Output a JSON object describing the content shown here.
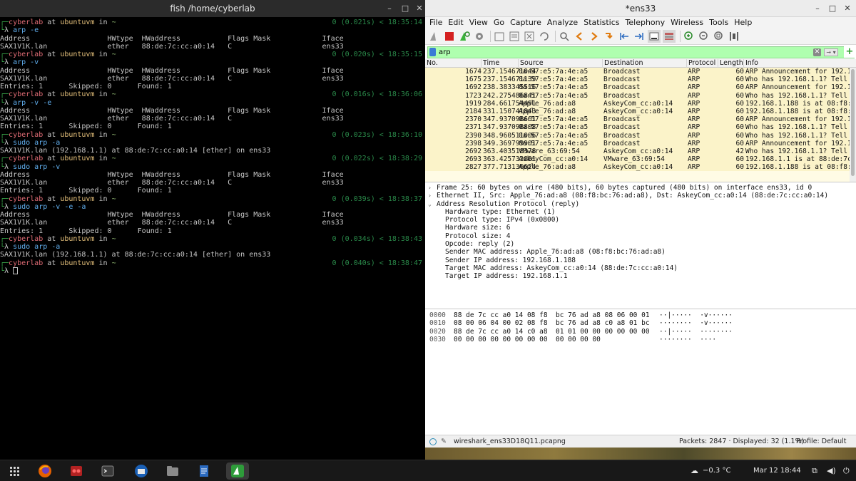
{
  "terminal": {
    "title": "fish /home/cyberlab",
    "lines": [
      {
        "t": "prompt",
        "user": "cyberlab",
        "at": " at ",
        "host": "ubuntuvm",
        "in": " in ",
        "dir": "~",
        "duration": "0 (0.021s)",
        "time": "< 18:35:14"
      },
      {
        "t": "cmd",
        "text": "arp -e"
      },
      {
        "t": "out",
        "text": "Address                  HWtype  HWaddress           Flags Mask            Iface"
      },
      {
        "t": "out",
        "text": "SAX1V1K.lan              ether   88:de:7c:cc:a0:14   C                     ens33"
      },
      {
        "t": "prompt",
        "user": "cyberlab",
        "at": " at ",
        "host": "ubuntuvm",
        "in": " in ",
        "dir": "~",
        "duration": "0 (0.020s)",
        "time": "< 18:35:15"
      },
      {
        "t": "cmd",
        "text": "arp -v"
      },
      {
        "t": "out",
        "text": "Address                  HWtype  HWaddress           Flags Mask            Iface"
      },
      {
        "t": "out",
        "text": "SAX1V1K.lan              ether   88:de:7c:cc:a0:14   C                     ens33"
      },
      {
        "t": "out",
        "text": "Entries: 1      Skipped: 0      Found: 1"
      },
      {
        "t": "prompt",
        "user": "cyberlab",
        "at": " at ",
        "host": "ubuntuvm",
        "in": " in ",
        "dir": "~",
        "duration": "0 (0.016s)",
        "time": "< 18:36:06"
      },
      {
        "t": "cmd",
        "text": "arp -v -e"
      },
      {
        "t": "out",
        "text": "Address                  HWtype  HWaddress           Flags Mask            Iface"
      },
      {
        "t": "out",
        "text": "SAX1V1K.lan              ether   88:de:7c:cc:a0:14   C                     ens33"
      },
      {
        "t": "out",
        "text": "Entries: 1      Skipped: 0      Found: 1"
      },
      {
        "t": "prompt",
        "user": "cyberlab",
        "at": " at ",
        "host": "ubuntuvm",
        "in": " in ",
        "dir": "~",
        "duration": "0 (0.023s)",
        "time": "< 18:36:10"
      },
      {
        "t": "cmd",
        "text": "sudo arp -a"
      },
      {
        "t": "out",
        "text": "SAX1V1K.lan (192.168.1.1) at 88:de:7c:cc:a0:14 [ether] on ens33"
      },
      {
        "t": "prompt",
        "user": "cyberlab",
        "at": " at ",
        "host": "ubuntuvm",
        "in": " in ",
        "dir": "~",
        "duration": "0 (0.022s)",
        "time": "< 18:38:29"
      },
      {
        "t": "cmd",
        "text": "sudo arp -v"
      },
      {
        "t": "out",
        "text": "Address                  HWtype  HWaddress           Flags Mask            Iface"
      },
      {
        "t": "out",
        "text": "SAX1V1K.lan              ether   88:de:7c:cc:a0:14   C                     ens33"
      },
      {
        "t": "out",
        "text": "Entries: 1      Skipped: 0      Found: 1"
      },
      {
        "t": "prompt",
        "user": "cyberlab",
        "at": " at ",
        "host": "ubuntuvm",
        "in": " in ",
        "dir": "~",
        "duration": "0 (0.039s)",
        "time": "< 18:38:37"
      },
      {
        "t": "cmd",
        "text": "sudo arp -v -e -a"
      },
      {
        "t": "out",
        "text": "Address                  HWtype  HWaddress           Flags Mask            Iface"
      },
      {
        "t": "out",
        "text": "SAX1V1K.lan              ether   88:de:7c:cc:a0:14   C                     ens33"
      },
      {
        "t": "out",
        "text": "Entries: 1      Skipped: 0      Found: 1"
      },
      {
        "t": "prompt",
        "user": "cyberlab",
        "at": " at ",
        "host": "ubuntuvm",
        "in": " in ",
        "dir": "~",
        "duration": "0 (0.034s)",
        "time": "< 18:38:43"
      },
      {
        "t": "cmd",
        "text": "sudo arp -a"
      },
      {
        "t": "out",
        "text": "SAX1V1K.lan (192.168.1.1) at 88:de:7c:cc:a0:14 [ether] on ens33"
      },
      {
        "t": "prompt",
        "user": "cyberlab",
        "at": " at ",
        "host": "ubuntuvm",
        "in": " in ",
        "dir": "~",
        "duration": "0 (0.040s)",
        "time": "< 18:38:47"
      },
      {
        "t": "input",
        "text": ""
      }
    ]
  },
  "wireshark": {
    "title": "*ens33",
    "menu": [
      "File",
      "Edit",
      "View",
      "Go",
      "Capture",
      "Analyze",
      "Statistics",
      "Telephony",
      "Wireless",
      "Tools",
      "Help"
    ],
    "toolbar_icons": [
      "shark-fin-icon",
      "stop-icon",
      "restart-icon",
      "options-gear-icon",
      "open-folder-icon",
      "save-icon",
      "close-file-icon",
      "reload-icon",
      "find-icon",
      "back-icon",
      "forward-icon",
      "goto-packet-icon",
      "first-packet-icon",
      "last-packet-icon",
      "autoscroll-icon",
      "colorize-icon",
      "zoom-in-icon",
      "zoom-out-icon",
      "zoom-normal-icon",
      "resize-columns-icon"
    ],
    "filter": {
      "value": "arp"
    },
    "columns": [
      "No.",
      "Time",
      "Source",
      "Destination",
      "Protocol",
      "Length",
      "Info"
    ],
    "packets": [
      {
        "no": "1674",
        "time": "237.154671044",
        "src": "0a:57:e5:7a:4e:a5",
        "dst": "Broadcast",
        "proto": "ARP",
        "len": "60",
        "info": "ARP Announcement for 192.1"
      },
      {
        "no": "1675",
        "time": "237.154671139",
        "src": "0a:57:e5:7a:4e:a5",
        "dst": "Broadcast",
        "proto": "ARP",
        "len": "60",
        "info": "Who has 192.168.1.1? Tell"
      },
      {
        "no": "1692",
        "time": "238.383345516",
        "src": "0a:57:e5:7a:4e:a5",
        "dst": "Broadcast",
        "proto": "ARP",
        "len": "60",
        "info": "ARP Announcement for 192.1"
      },
      {
        "no": "1723",
        "time": "242.275486841",
        "src": "0a:57:e5:7a:4e:a5",
        "dst": "Broadcast",
        "proto": "ARP",
        "len": "60",
        "info": "Who has 192.168.1.1? Tell"
      },
      {
        "no": "1919",
        "time": "284.661754491",
        "src": "Apple_76:ad:a8",
        "dst": "AskeyCom_cc:a0:14",
        "proto": "ARP",
        "len": "60",
        "info": "192.168.1.188 is at 08:f8:"
      },
      {
        "no": "2184",
        "time": "331.150741843",
        "src": "Apple_76:ad:a8",
        "dst": "AskeyCom_cc:a0:14",
        "proto": "ARP",
        "len": "60",
        "info": "192.168.1.188 is at 08:f8:"
      },
      {
        "no": "2370",
        "time": "347.937098661",
        "src": "0a:57:e5:7a:4e:a5",
        "dst": "Broadcast",
        "proto": "ARP",
        "len": "60",
        "info": "ARP Announcement for 192.1"
      },
      {
        "no": "2371",
        "time": "347.937098808",
        "src": "0a:57:e5:7a:4e:a5",
        "dst": "Broadcast",
        "proto": "ARP",
        "len": "60",
        "info": "Who has 192.168.1.1? Tell"
      },
      {
        "no": "2390",
        "time": "348.960511006",
        "src": "0a:57:e5:7a:4e:a5",
        "dst": "Broadcast",
        "proto": "ARP",
        "len": "60",
        "info": "Who has 192.168.1.1? Tell"
      },
      {
        "no": "2398",
        "time": "349.369799901",
        "src": "0a:57:e5:7a:4e:a5",
        "dst": "Broadcast",
        "proto": "ARP",
        "len": "60",
        "info": "ARP Announcement for 192.1"
      },
      {
        "no": "2692",
        "time": "363.403518378",
        "src": "VMware_63:69:54",
        "dst": "AskeyCom_cc:a0:14",
        "proto": "ARP",
        "len": "42",
        "info": "Who has 192.168.1.1? Tell"
      },
      {
        "no": "2693",
        "time": "363.425733881",
        "src": "AskeyCom_cc:a0:14",
        "dst": "VMware_63:69:54",
        "proto": "ARP",
        "len": "60",
        "info": "192.168.1.1 is at 88:de:7c"
      },
      {
        "no": "2827",
        "time": "377.713136624",
        "src": "Apple_76:ad:a8",
        "dst": "AskeyCom_cc:a0:14",
        "proto": "ARP",
        "len": "60",
        "info": "192.168.1.188 is at 08:f8:"
      }
    ],
    "details": [
      {
        "arrow": "›",
        "indent": 0,
        "text": "Frame 25: 60 bytes on wire (480 bits), 60 bytes captured (480 bits) on interface ens33, id 0"
      },
      {
        "arrow": "›",
        "indent": 0,
        "text": "Ethernet II, Src: Apple_76:ad:a8 (08:f8:bc:76:ad:a8), Dst: AskeyCom_cc:a0:14 (88:de:7c:cc:a0:14)"
      },
      {
        "arrow": "⌄",
        "indent": 0,
        "text": "Address Resolution Protocol (reply)"
      },
      {
        "arrow": "",
        "indent": 1,
        "text": "Hardware type: Ethernet (1)"
      },
      {
        "arrow": "",
        "indent": 1,
        "text": "Protocol type: IPv4 (0x0800)"
      },
      {
        "arrow": "",
        "indent": 1,
        "text": "Hardware size: 6"
      },
      {
        "arrow": "",
        "indent": 1,
        "text": "Protocol size: 4"
      },
      {
        "arrow": "",
        "indent": 1,
        "text": "Opcode: reply (2)"
      },
      {
        "arrow": "",
        "indent": 1,
        "text": "Sender MAC address: Apple_76:ad:a8 (08:f8:bc:76:ad:a8)"
      },
      {
        "arrow": "",
        "indent": 1,
        "text": "Sender IP address: 192.168.1.188"
      },
      {
        "arrow": "",
        "indent": 1,
        "text": "Target MAC address: AskeyCom_cc:a0:14 (88:de:7c:cc:a0:14)"
      },
      {
        "arrow": "",
        "indent": 1,
        "text": "Target IP address: 192.168.1.1"
      }
    ],
    "bytes": [
      {
        "off": "0000",
        "hex": "88 de 7c cc a0 14 08 f8  bc 76 ad a8 08 06 00 01",
        "asc": "··|·····  ·v······"
      },
      {
        "off": "0010",
        "hex": "08 00 06 04 00 02 08 f8  bc 76 ad a8 c0 a8 01 bc",
        "asc": "········  ·v······"
      },
      {
        "off": "0020",
        "hex": "88 de 7c cc a0 14 c0 a8  01 01 00 00 00 00 00 00",
        "asc": "··|·····  ········"
      },
      {
        "off": "0030",
        "hex": "00 00 00 00 00 00 00 00  00 00 00 00",
        "asc": "········  ····"
      }
    ],
    "status": {
      "file": "wireshark_ens33D18Q11.pcapng",
      "packets": "Packets: 2847 · Displayed: 32 (1.1%)",
      "profile": "Profile: Default"
    }
  },
  "taskbar": {
    "apps": [
      "apps-grid-icon",
      "firefox-icon",
      "cherrytree-icon",
      "terminal-icon",
      "thunderbird-icon",
      "files-icon",
      "text-editor-icon",
      "wireshark-icon"
    ],
    "weather": "−0.3 °C",
    "clock": "Mar 12  18:44"
  }
}
